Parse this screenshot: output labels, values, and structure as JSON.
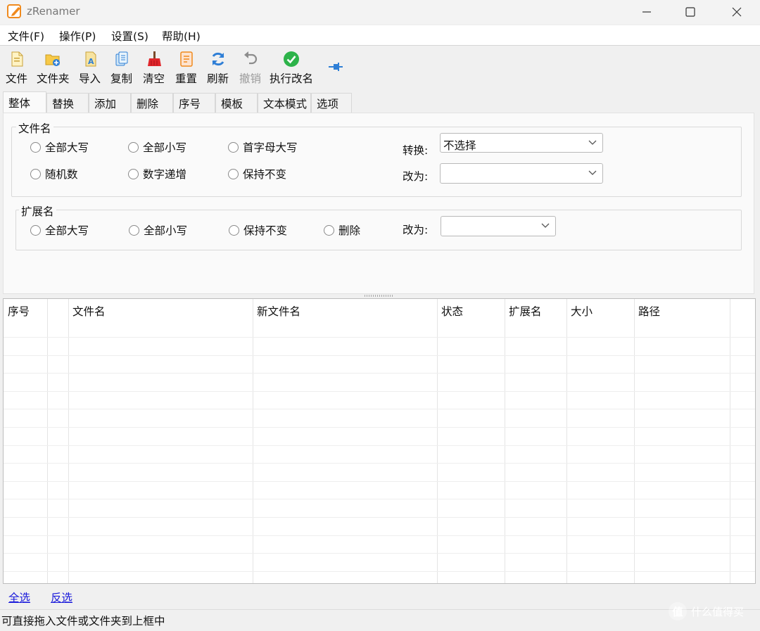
{
  "window": {
    "title": "zRenamer",
    "controls": [
      "minimize-icon",
      "maximize-icon",
      "close-icon"
    ]
  },
  "menu": [
    "文件(F)",
    "操作(P)",
    "设置(S)",
    "帮助(H)"
  ],
  "toolbar": {
    "items": [
      {
        "label": "文件",
        "icon": "file-add-icon",
        "enabled": true
      },
      {
        "label": "文件夹",
        "icon": "folder-add-icon",
        "enabled": true
      },
      {
        "label": "导入",
        "icon": "import-icon",
        "enabled": true
      },
      {
        "label": "复制",
        "icon": "copy-icon",
        "enabled": true
      },
      {
        "label": "清空",
        "icon": "broom-icon",
        "enabled": true
      },
      {
        "label": "重置",
        "icon": "reset-icon",
        "enabled": true
      },
      {
        "label": "刷新",
        "icon": "refresh-icon",
        "enabled": true
      },
      {
        "label": "撤销",
        "icon": "undo-icon",
        "enabled": false
      },
      {
        "label": "执行改名",
        "icon": "check-circle-icon",
        "enabled": true
      }
    ],
    "pin_icon": "pin-icon"
  },
  "tabs": {
    "items": [
      "整体",
      "替换",
      "添加",
      "删除",
      "序号",
      "模板",
      "文本模式",
      "选项"
    ],
    "active": "整体"
  },
  "filename_group": {
    "title": "文件名",
    "options": [
      "全部大写",
      "全部小写",
      "首字母大写",
      "随机数",
      "数字递增",
      "保持不变"
    ],
    "convert_label": "转换:",
    "convert_value": "不选择",
    "change_label": "改为:",
    "change_value": ""
  },
  "extension_group": {
    "title": "扩展名",
    "options": [
      "全部大写",
      "全部小写",
      "保持不变",
      "删除"
    ],
    "change_label": "改为:",
    "change_value": ""
  },
  "table": {
    "columns": [
      "序号",
      "",
      "文件名",
      "新文件名",
      "状态",
      "扩展名",
      "大小",
      "路径"
    ],
    "rows": []
  },
  "footer": {
    "select_all": "全选",
    "invert_select": "反选"
  },
  "status": "可直接拖入文件或文件夹到上框中",
  "watermark": {
    "logo": "值",
    "text": "什么值得买"
  },
  "colors": {
    "accent_orange": "#f08a1d",
    "check_green": "#2db34a",
    "refresh_blue": "#2f7fd6",
    "broom_red": "#e0262b",
    "link_blue": "#1a1adb"
  }
}
